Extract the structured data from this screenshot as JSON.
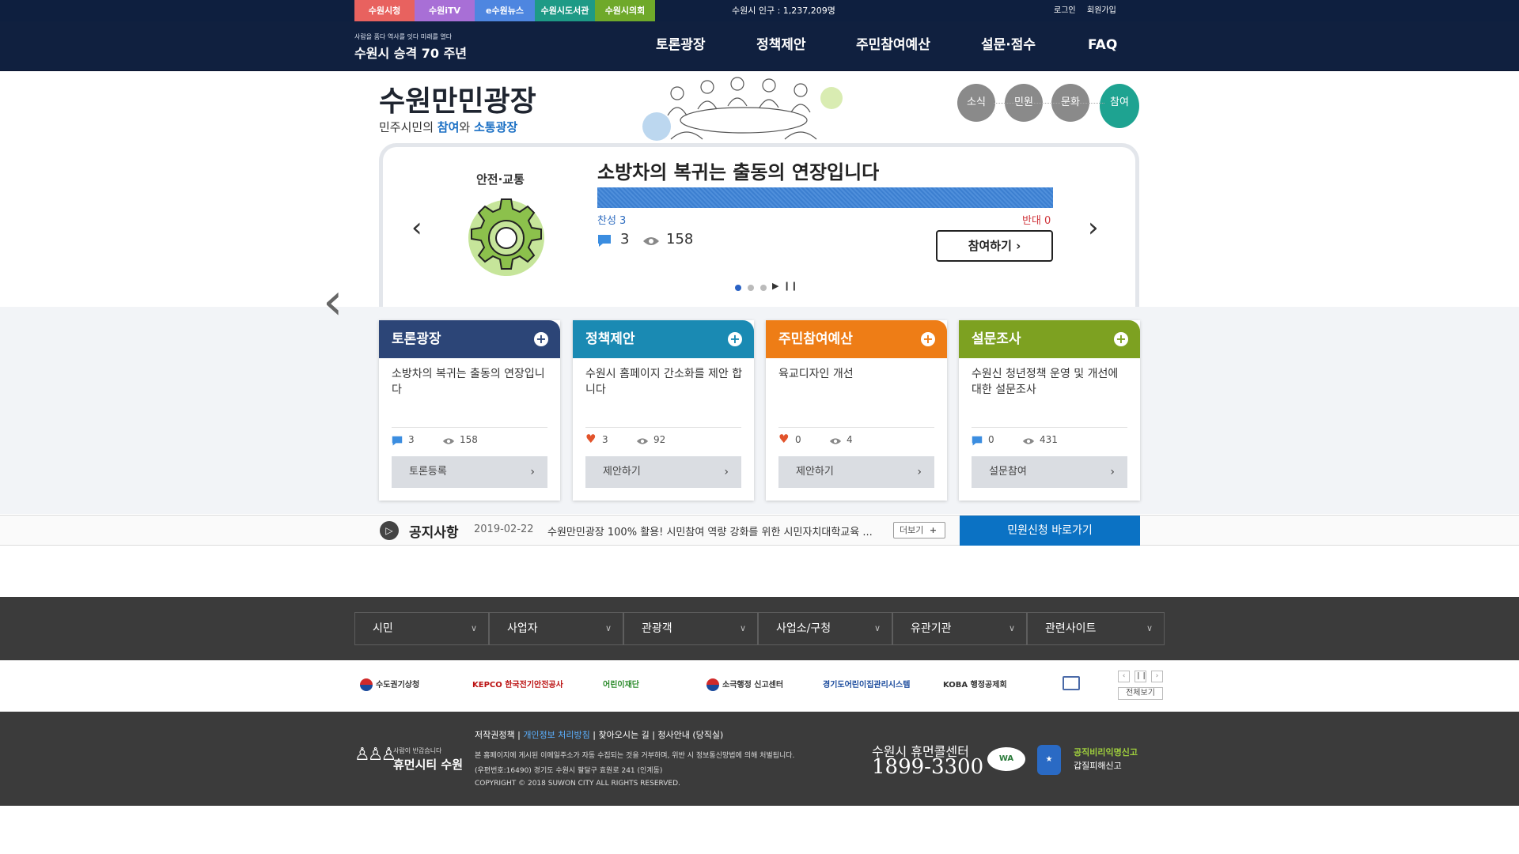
{
  "topbar": {
    "tabs": [
      {
        "label": "수원시청",
        "color": "#e8625f"
      },
      {
        "label": "수원iTV",
        "color": "#a86fd6"
      },
      {
        "label": "e수원뉴스",
        "color": "#4e86e0"
      },
      {
        "label": "수원시도서관",
        "color": "#1e9a86"
      },
      {
        "label": "수원시의회",
        "color": "#6fa92a"
      }
    ],
    "population": "수원시 인구 : 1,237,209명",
    "login": "로그인",
    "signup": "회원가입"
  },
  "header": {
    "logo_tagline": "사람을 품다  역사를 잇다  미래를 열다",
    "logo_text": "수원시 승격 70 주년",
    "nav": [
      "토론광장",
      "정책제안",
      "주민참여예산",
      "설문·점수",
      "FAQ"
    ]
  },
  "hero": {
    "title": "수원만민광장",
    "subtitle_pre": "민주시민의 ",
    "subtitle_accent1": "참여",
    "subtitle_mid": "와 ",
    "subtitle_accent2": "소통광장",
    "circle_tabs": [
      {
        "label": "소식",
        "active": false
      },
      {
        "label": "민원",
        "active": false
      },
      {
        "label": "문화",
        "active": false
      },
      {
        "label": "참여",
        "active": true
      }
    ]
  },
  "slide": {
    "category": "안전·교통",
    "title": "소방차의 복귀는 출동의 연장입니다",
    "agree_label": "찬성 3",
    "oppose_label": "반대 0",
    "agree_ratio": 1.0,
    "comments": "3",
    "views": "158",
    "join_button": "참여하기",
    "dots": 3
  },
  "cards": [
    {
      "title": "토론광장",
      "color": "#2c4577",
      "text": "소방차의 복귀는 출동의 연장입니다",
      "icon": "comment-icon",
      "stat1": "3",
      "stat2": "158",
      "button": "토론등록"
    },
    {
      "title": "정책제안",
      "color": "#1a8ab3",
      "text": "수원시 홈페이지 간소화를 제안 합니다",
      "icon": "heart-icon",
      "stat1": "3",
      "stat2": "92",
      "button": "제안하기"
    },
    {
      "title": "주민참여예산",
      "color": "#ee7d16",
      "text": "육교디자인 개선",
      "icon": "heart-icon",
      "stat1": "0",
      "stat2": "4",
      "button": "제안하기"
    },
    {
      "title": "설문조사",
      "color": "#7da121",
      "text": "수원신 청년정책 운영 및 개선에 대한 설문조사",
      "icon": "comment-icon",
      "stat1": "0",
      "stat2": "431",
      "button": "설문참여"
    }
  ],
  "notice": {
    "title": "공지사항",
    "date": "2019-02-22",
    "text": "수원만민광장 100% 활용! 시민참여 역량 강화를 위한 시민자치대학교육 ...",
    "more": "더보기",
    "civil_button": "민원신청 바로가기"
  },
  "footer": {
    "selects": [
      "시민",
      "사업자",
      "관광객",
      "사업소/구청",
      "유관기관",
      "관련사이트"
    ],
    "partners": [
      "수도권기상청",
      "KEPCO 한국전기안전공사",
      "어린이재단",
      "소극행정 신고센터",
      "경기도어린이집관리시스템",
      "KOBA 행정공제회"
    ],
    "view_all": "전체보기",
    "logo_tagline": "사람이 반갑습니다",
    "logo_text": "휴먼시티 수원",
    "links": [
      "저작권정책",
      "개인정보 처리방침",
      "찾아오시는 길",
      "청사안내 (당직실)"
    ],
    "info": [
      "본 홈페이지에 게시된 이메일주소가 자동 수집되는 것을 거부하며, 위반 시 정보통신망법에 의해 처벌됩니다.",
      "(우편번호:16490) 경기도 수원시 팔달구 효원로 241 (인계동)",
      "COPYRIGHT © 2018 SUWON CITY ALL RIGHTS RESERVED."
    ],
    "callcenter_label": "수원시 휴먼콜센터",
    "callcenter_number": "1899-3300",
    "report1": "공직비리익명신고",
    "report2": "갑질피해신고"
  }
}
